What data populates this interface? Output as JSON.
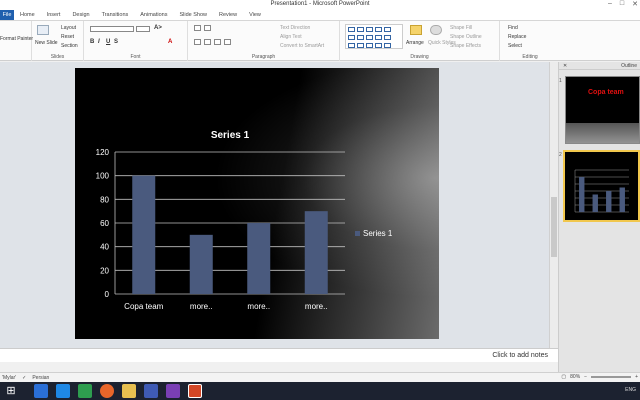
{
  "window": {
    "title": "Presentation1 - Microsoft PowerPoint"
  },
  "tabs": [
    "File",
    "Home",
    "Insert",
    "Design",
    "Transitions",
    "Animations",
    "Slide Show",
    "Review",
    "View"
  ],
  "ribbon": {
    "clipboard": {
      "format_painter": "Format Painter",
      "label": ""
    },
    "slides": {
      "new_slide": "New Slide",
      "layout": "Layout",
      "reset": "Reset",
      "section": "Section",
      "label": "Slides"
    },
    "font": {
      "label": "Font"
    },
    "paragraph": {
      "text_direction": "Text Direction",
      "align_text": "Align Text",
      "smartart": "Convert to SmartArt",
      "label": "Paragraph"
    },
    "drawing": {
      "arrange": "Arrange",
      "quick_styles": "Quick Styles",
      "shape_fill": "Shape Fill",
      "shape_outline": "Shape Outline",
      "shape_effects": "Shape Effects",
      "label": "Drawing"
    },
    "editing": {
      "find": "Find",
      "replace": "Replace",
      "select": "Select",
      "label": "Editing"
    }
  },
  "pane": {
    "tab_outline": "Outline",
    "slide1_title": "Copa team"
  },
  "notes": {
    "placeholder": "Click to add notes"
  },
  "status": {
    "theme": "'Mylar'",
    "language": "Persian",
    "zoom": "80%"
  },
  "tray": {
    "lang": "ENG"
  },
  "chart_data": {
    "type": "bar",
    "title": "Series 1",
    "categories": [
      "Copa team",
      "more..",
      "more..",
      "more.."
    ],
    "series": [
      {
        "name": "Series 1",
        "values": [
          100,
          50,
          60,
          70
        ]
      }
    ],
    "ylim": [
      0,
      120
    ],
    "yticks": [
      0,
      20,
      40,
      60,
      80,
      100,
      120
    ],
    "grid": true,
    "legend": "right",
    "colors": {
      "bar": "#4a5a7e",
      "grid": "#bfbfbf",
      "text": "#ffffff"
    }
  }
}
